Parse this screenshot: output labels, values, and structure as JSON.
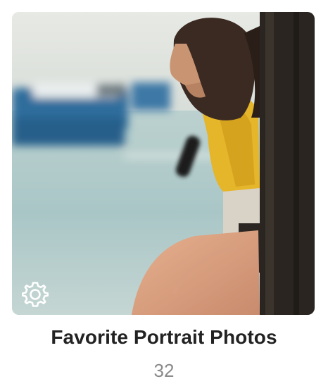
{
  "album": {
    "title": "Favorite Portrait Photos",
    "count": "32",
    "badge_icon": "gear-icon",
    "colors": {
      "title": "#222222",
      "count": "#8a8a8a"
    }
  }
}
